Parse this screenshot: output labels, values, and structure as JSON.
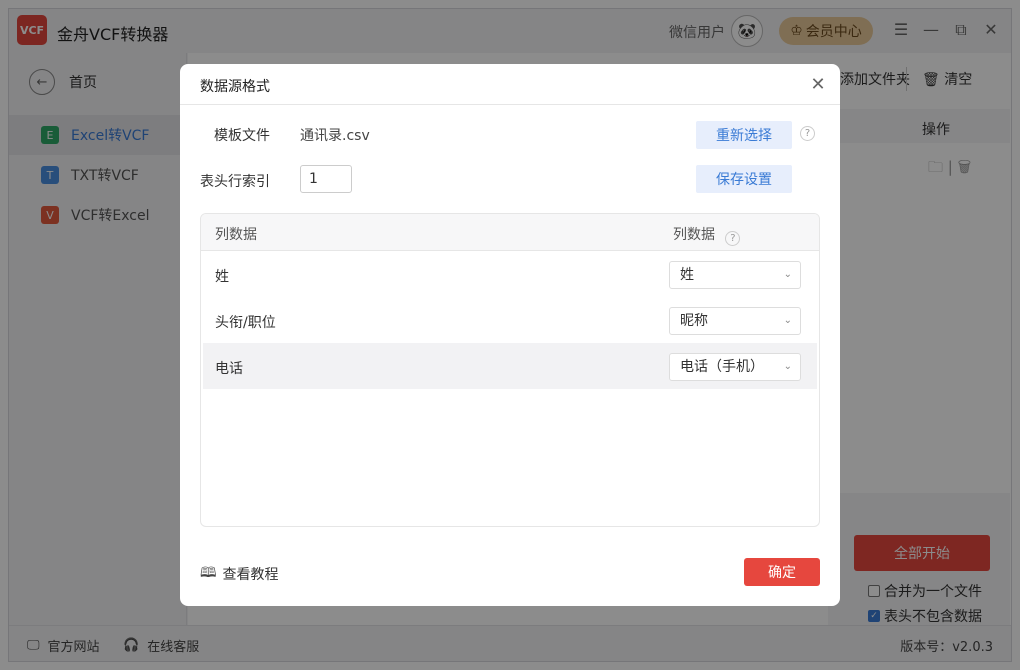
{
  "app": {
    "title": "金舟VCF转换器",
    "logo_text": "VCF",
    "user_name": "微信用户",
    "avatar_icon": "panda-avatar",
    "vip_label": "会员中心"
  },
  "sidebar": {
    "home_label": "首页",
    "items": [
      {
        "badge": "E",
        "label": "Excel转VCF",
        "color": "#2ea866",
        "active": true
      },
      {
        "badge": "T",
        "label": "TXT转VCF",
        "color": "#4a8fe0",
        "active": false
      },
      {
        "badge": "V",
        "label": "VCF转Excel",
        "color": "#e2593c",
        "active": false
      }
    ]
  },
  "main": {
    "add_folder_label": "添加文件夹",
    "clear_label": "清空",
    "op_header": "操作",
    "start_all_label": "全部开始",
    "merge_label": "合并为一个文件",
    "merge_checked": false,
    "no_header_label": "表头不包含数据",
    "no_header_checked": true
  },
  "footer": {
    "website_label": "官方网站",
    "support_label": "在线客服",
    "version": "版本号：v2.0.3"
  },
  "dialog": {
    "title": "数据源格式",
    "template_label": "模板文件",
    "template_file": "通讯录.csv",
    "reselect_label": "重新选择",
    "header_index_label": "表头行索引",
    "header_index_value": "1",
    "save_settings_label": "保存设置",
    "table_header_left": "列数据",
    "table_header_right": "列数据",
    "rows": [
      {
        "source": "姓",
        "target": "姓"
      },
      {
        "source": "头衔/职位",
        "target": "昵称"
      },
      {
        "source": "电话",
        "target": "电话（手机）"
      }
    ],
    "tutorial_label": "查看教程",
    "confirm_label": "确定"
  }
}
